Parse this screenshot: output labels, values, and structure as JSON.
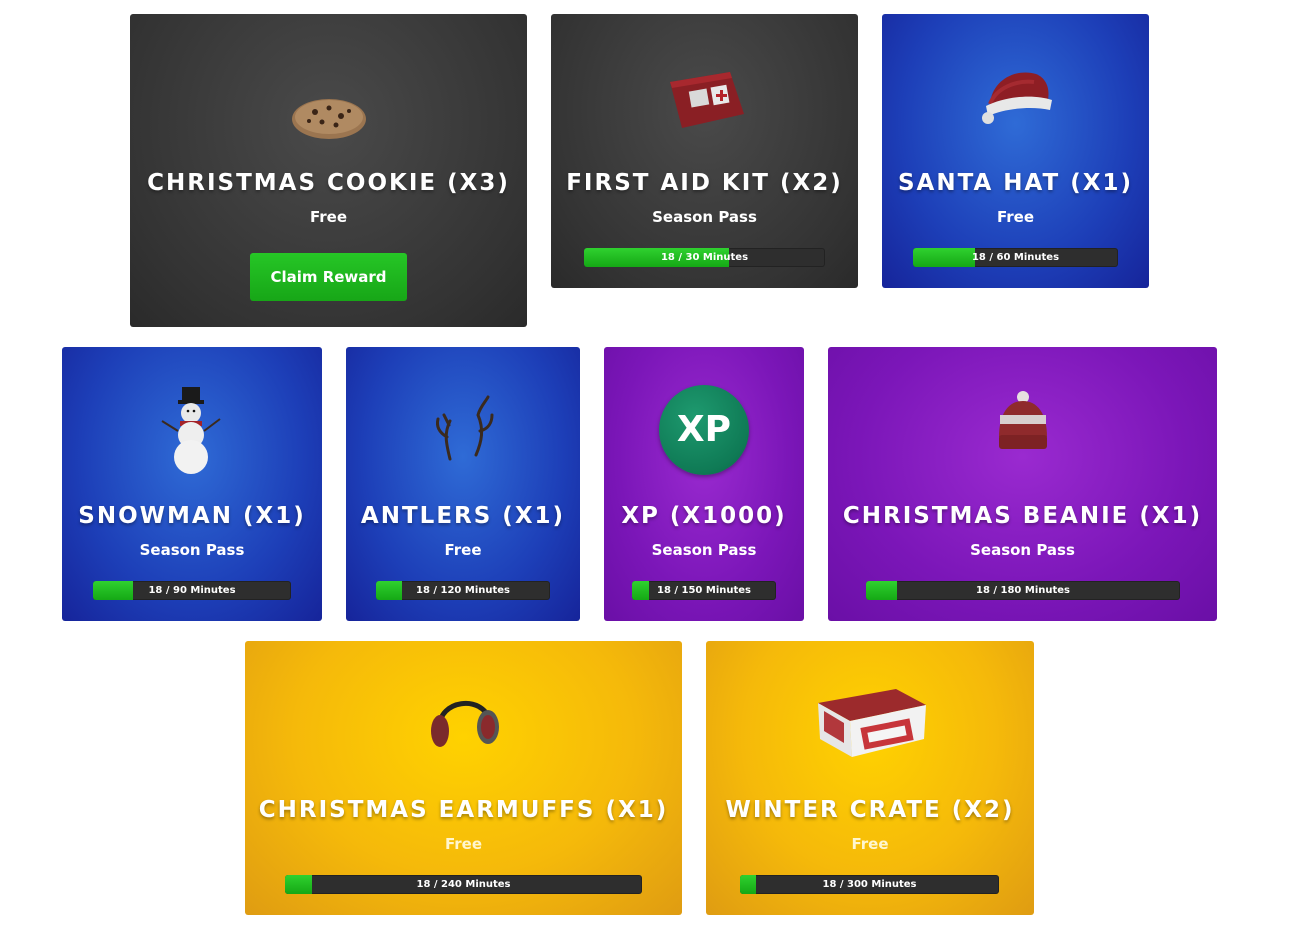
{
  "rewards": [
    {
      "name": "CHRISTMAS COOKIE (X3)",
      "tier": "Free",
      "button": "Claim Reward",
      "icon": "cookie-icon",
      "theme": "dark"
    },
    {
      "name": "FIRST AID KIT (X2)",
      "tier": "Season Pass",
      "progress": "18 / 30 Minutes",
      "progress_value": 0.6,
      "icon": "first-aid-kit-icon",
      "theme": "dark"
    },
    {
      "name": "SANTA HAT (X1)",
      "tier": "Free",
      "progress": "18 / 60 Minutes",
      "progress_value": 0.3,
      "icon": "santa-hat-icon",
      "theme": "blue"
    },
    {
      "name": "SNOWMAN (X1)",
      "tier": "Season Pass",
      "progress": "18 / 90 Minutes",
      "progress_value": 0.2,
      "icon": "snowman-icon",
      "theme": "blue"
    },
    {
      "name": "ANTLERS (X1)",
      "tier": "Free",
      "progress": "18 / 120 Minutes",
      "progress_value": 0.15,
      "icon": "antlers-icon",
      "theme": "blue"
    },
    {
      "name": "XP (X1000)",
      "tier": "Season Pass",
      "progress": "18 / 150 Minutes",
      "progress_value": 0.12,
      "icon": "xp-icon",
      "badge": "XP",
      "theme": "purple"
    },
    {
      "name": "CHRISTMAS BEANIE (X1)",
      "tier": "Season Pass",
      "progress": "18 / 180 Minutes",
      "progress_value": 0.1,
      "icon": "beanie-icon",
      "theme": "purple"
    },
    {
      "name": "CHRISTMAS EARMUFFS (X1)",
      "tier": "Free",
      "progress": "18 / 240 Minutes",
      "progress_value": 0.075,
      "icon": "earmuffs-icon",
      "theme": "gold"
    },
    {
      "name": "WINTER CRATE (X2)",
      "tier": "Free",
      "progress": "18 / 300 Minutes",
      "progress_value": 0.06,
      "icon": "winter-crate-icon",
      "theme": "gold"
    }
  ],
  "colors": {
    "progress_fill": "#22bb22",
    "claim_button": "#1fb51f",
    "dark": "#3a3a3a",
    "blue": "#1d3fb8",
    "purple": "#7b16b8",
    "gold": "#f5b90a"
  }
}
